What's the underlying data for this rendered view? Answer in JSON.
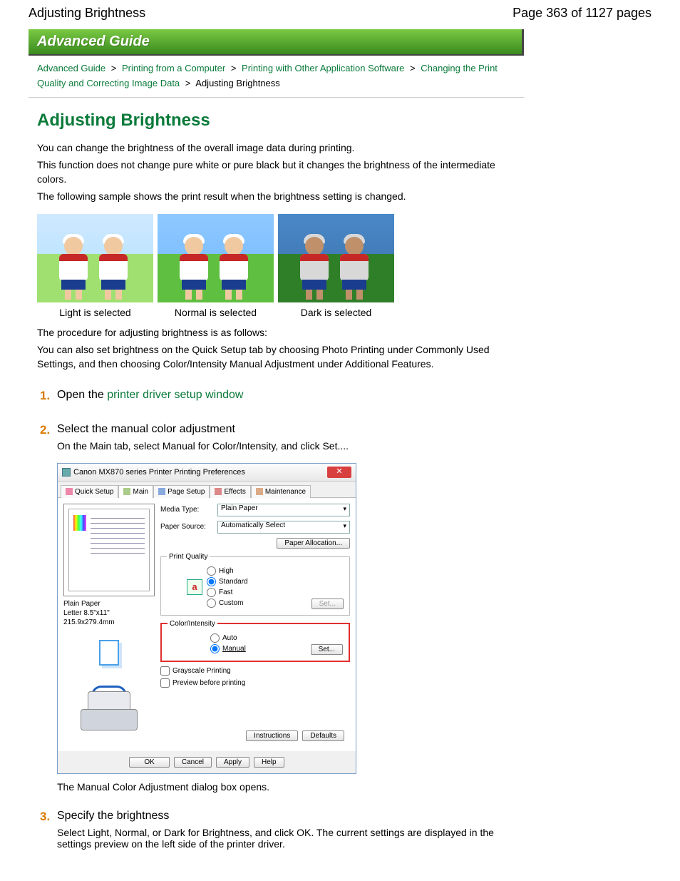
{
  "header": {
    "title": "Adjusting Brightness",
    "page_indicator": "Page 363 of 1127 pages"
  },
  "banner": "Advanced Guide",
  "breadcrumb": {
    "items": [
      "Advanced Guide",
      "Printing from a Computer",
      "Printing with Other Application Software",
      "Changing the Print Quality and Correcting Image Data"
    ],
    "current": "Adjusting Brightness",
    "sep": ">"
  },
  "title": "Adjusting Brightness",
  "intro": {
    "p1": "You can change the brightness of the overall image data during printing.",
    "p2": "This function does not change pure white or pure black but it changes the brightness of the intermediate colors.",
    "p3": "The following sample shows the print result when the brightness setting is changed."
  },
  "samples": {
    "light": "Light is selected",
    "normal": "Normal is selected",
    "dark": "Dark is selected"
  },
  "after_samples": {
    "p1": "The procedure for adjusting brightness is as follows:",
    "p2": "You can also set brightness on the Quick Setup tab by choosing Photo Printing under Commonly Used Settings, and then choosing Color/Intensity Manual Adjustment under Additional Features."
  },
  "steps": {
    "s1": {
      "num": "1.",
      "pre": "Open the ",
      "link": "printer driver setup window"
    },
    "s2": {
      "num": "2.",
      "title": "Select the manual color adjustment",
      "desc": "On the Main tab, select Manual for Color/Intensity, and click Set...."
    },
    "s3": {
      "num": "3.",
      "title": "Specify the brightness",
      "desc": "Select Light, Normal, or Dark for Brightness, and click OK. The current settings are displayed in the settings preview on the left side of the printer driver."
    },
    "after_dialog": "The Manual Color Adjustment dialog box opens."
  },
  "dialog": {
    "window_title": "Canon MX870 series Printer Printing Preferences",
    "tabs": {
      "quick": "Quick Setup",
      "main": "Main",
      "page": "Page Setup",
      "effects": "Effects",
      "maint": "Maintenance"
    },
    "labels": {
      "media": "Media Type:",
      "source": "Paper Source:",
      "pq": "Print Quality",
      "ci": "Color/Intensity"
    },
    "values": {
      "media": "Plain Paper",
      "source": "Automatically Select"
    },
    "buttons": {
      "paper_alloc": "Paper Allocation...",
      "set": "Set...",
      "instructions": "Instructions",
      "defaults": "Defaults",
      "ok": "OK",
      "cancel": "Cancel",
      "apply": "Apply",
      "help": "Help"
    },
    "pq_opts": {
      "high": "High",
      "standard": "Standard",
      "fast": "Fast",
      "custom": "Custom"
    },
    "ci_opts": {
      "auto": "Auto",
      "manual": "Manual"
    },
    "checks": {
      "gray": "Grayscale Printing",
      "preview": "Preview before printing"
    },
    "preview": {
      "line1": "Plain Paper",
      "line2": "Letter 8.5\"x11\" 215.9x279.4mm"
    }
  }
}
